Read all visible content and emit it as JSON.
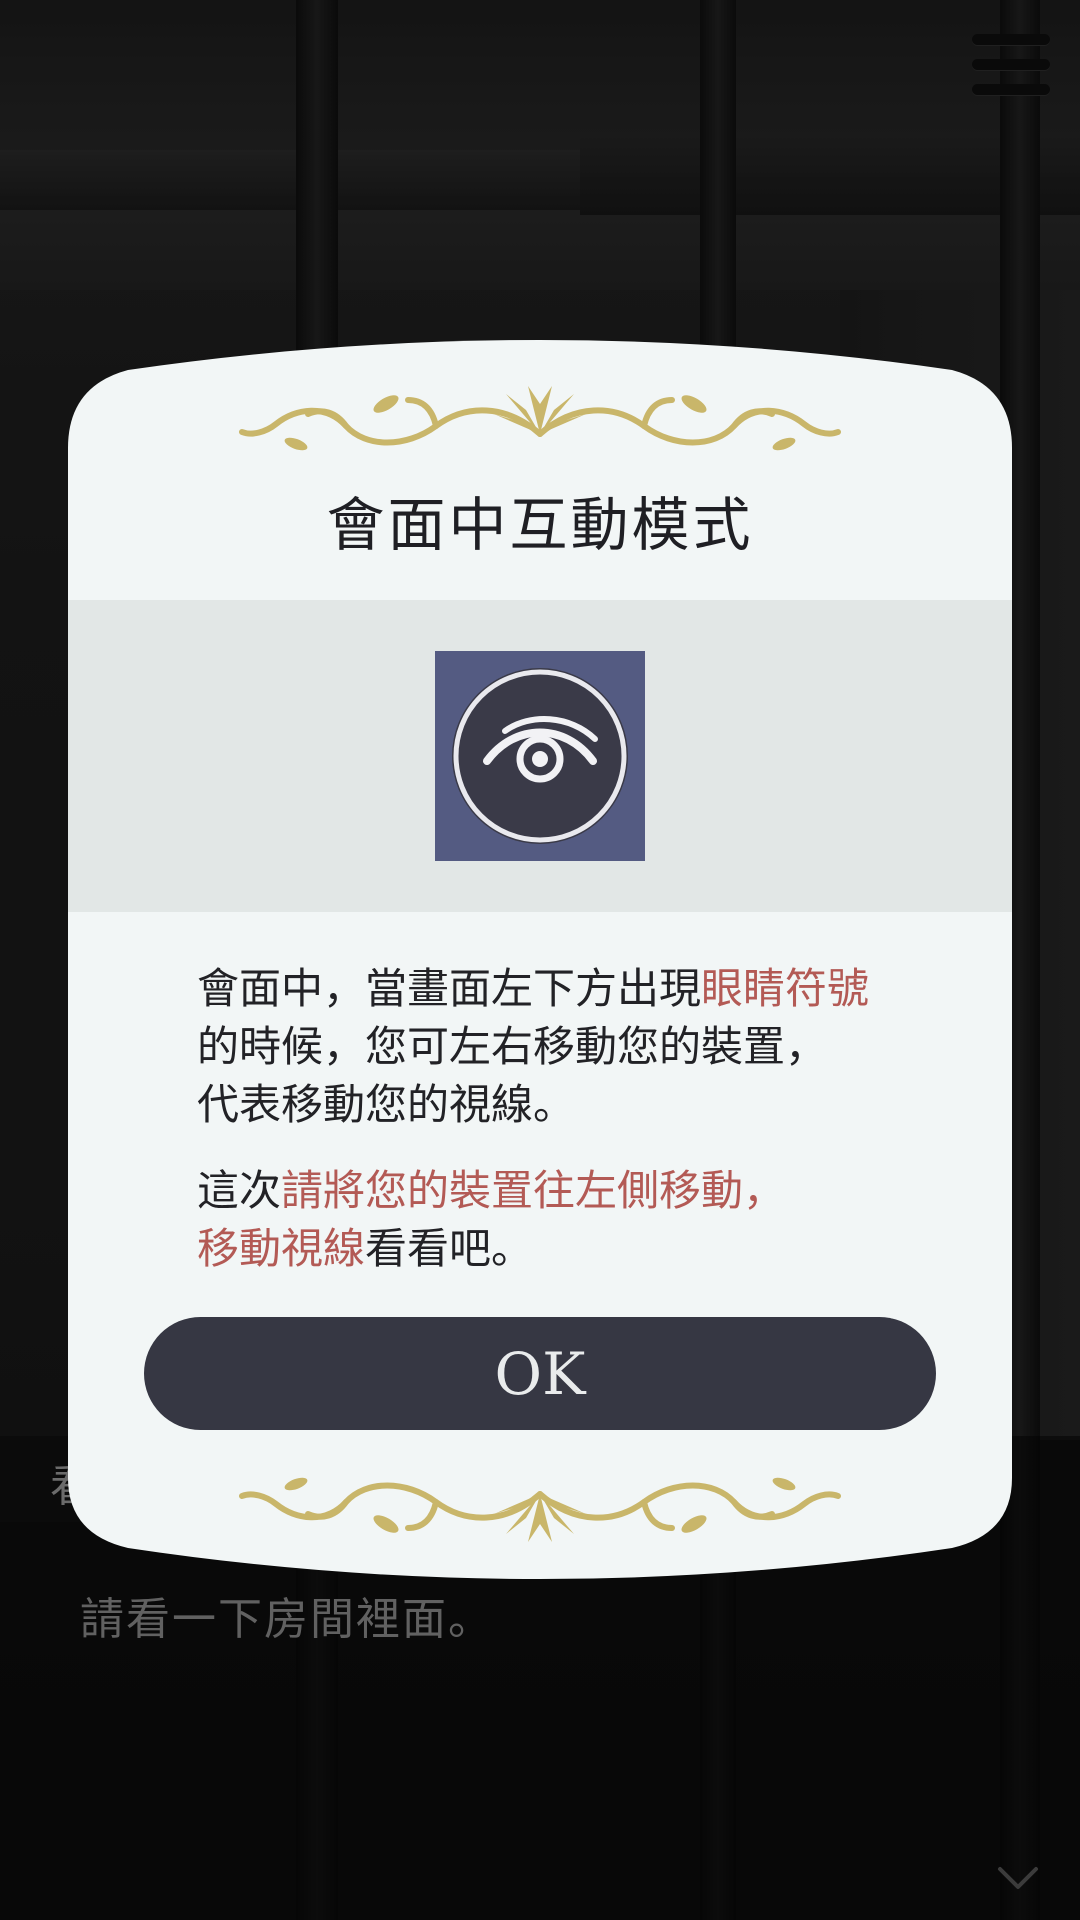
{
  "background": {
    "speaker_name": "看",
    "dialogue_text": "請看一下房間裡面。"
  },
  "modal": {
    "title": "會面中互動模式",
    "icon": "eye-icon",
    "paragraph1": {
      "line1_plain": "會面中，當畫面左下方出現",
      "line1_highlight": "眼睛符號",
      "line2": "的時候，您可左右移動您的裝置，",
      "line3": "代表移動您的視線。"
    },
    "paragraph2": {
      "line1_plain": "這次",
      "line1_highlight": "請將您的裝置往左側移動，",
      "line2_highlight": "移動視線",
      "line2_plain": "看看吧。"
    },
    "ok_label": "OK"
  },
  "colors": {
    "highlight": "#b35a55",
    "button": "#363743",
    "icon_tile": "#545b82",
    "ornament": "#c9b66a",
    "modal_bg": "#f2f6f6"
  }
}
